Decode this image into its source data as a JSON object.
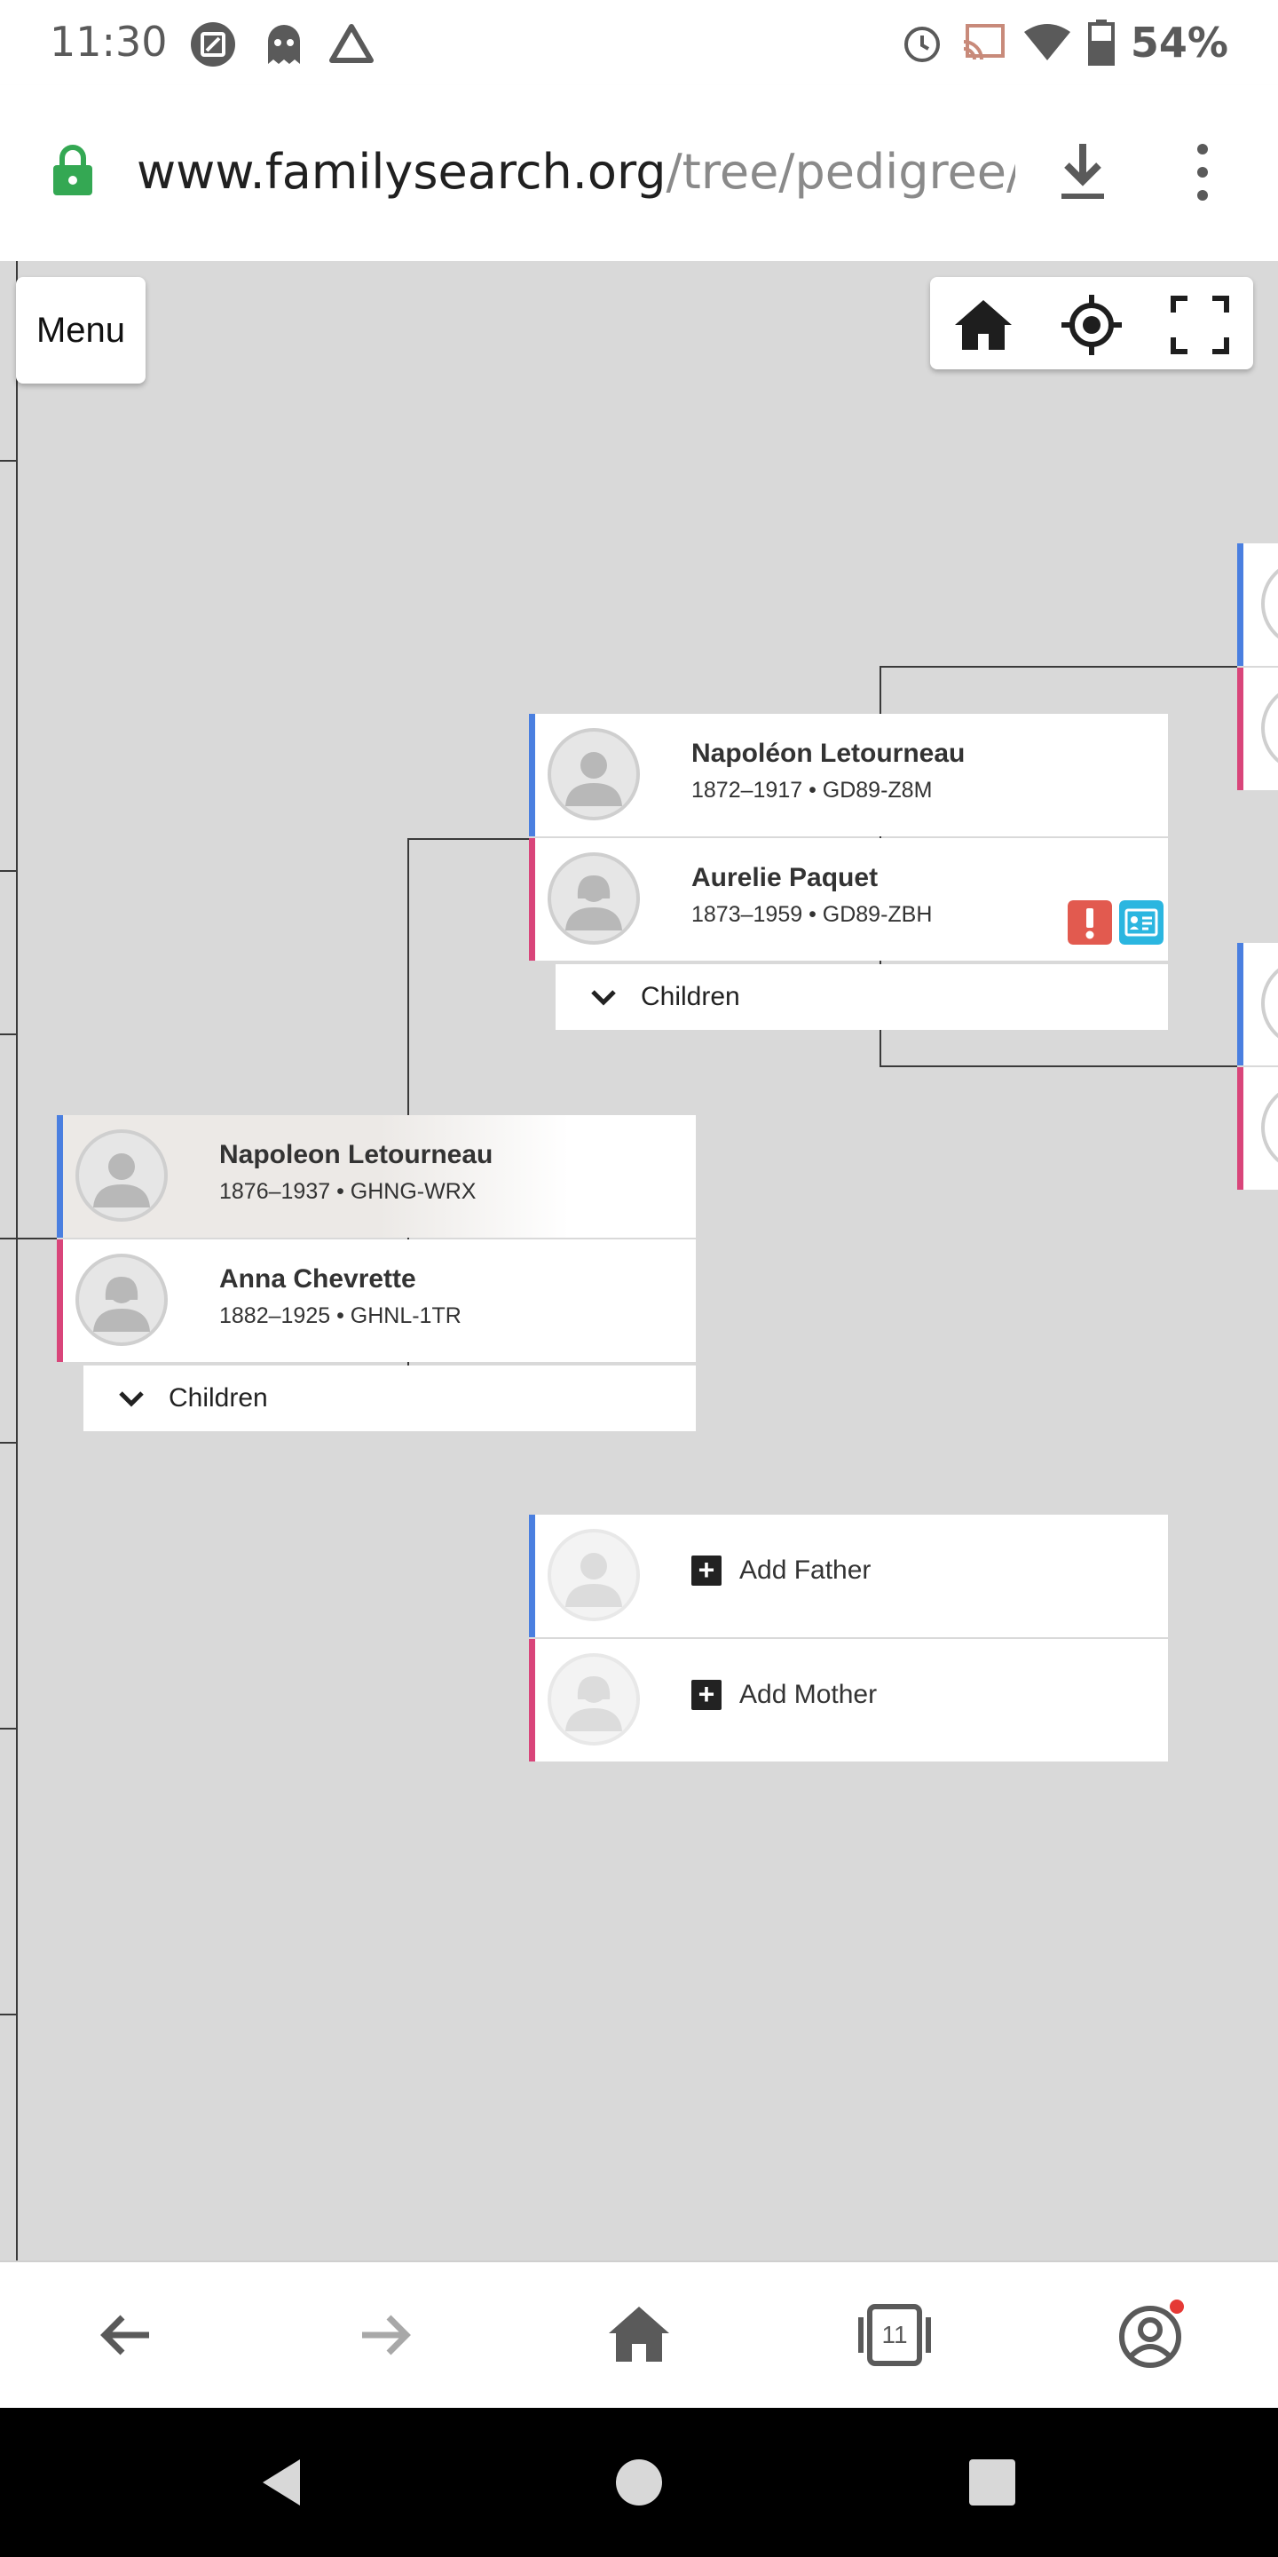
{
  "status_bar": {
    "time": "11:30",
    "battery": "54%"
  },
  "browser": {
    "url_domain": "www.familysearch.org",
    "url_path": "/tree/pedigree/la"
  },
  "toolbar": {
    "menu_label": "Menu"
  },
  "tree": {
    "focus": {
      "father": {
        "name": "Napoleon Letourneau",
        "info": "1876–1937 • GHNG-WRX"
      },
      "mother": {
        "name": "Anna Chevrette",
        "info": "1882–1925 • GHNL-1TR"
      },
      "children_label": "Children"
    },
    "father_parents": {
      "father": {
        "name": "Napoléon Letourneau",
        "info": "1872–1917 • GD89-Z8M"
      },
      "mother": {
        "name": "Aurelie Paquet",
        "info": "1873–1959 • GD89-ZBH"
      },
      "children_label": "Children"
    },
    "mother_parents": {
      "add_father_label": "Add Father",
      "add_mother_label": "Add Mother"
    }
  },
  "bottom_nav": {
    "tab_count": "11"
  },
  "colors": {
    "male": "#4a7fe0",
    "female": "#d9457a",
    "alert": "#e25a4f",
    "record": "#2bb6e0",
    "lock": "#34a853"
  }
}
